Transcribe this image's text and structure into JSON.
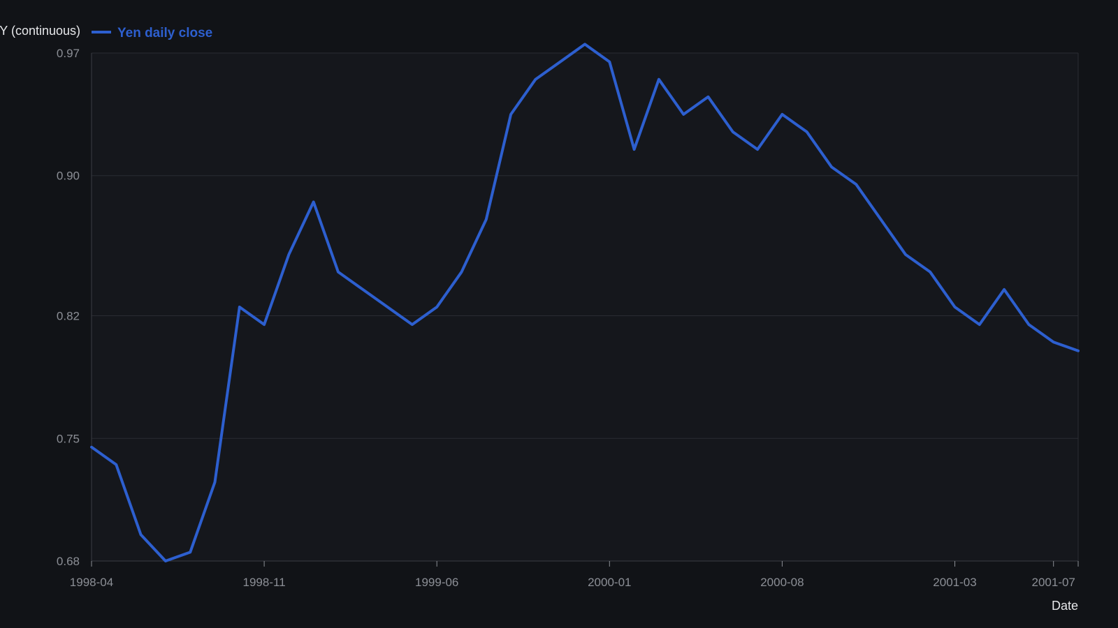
{
  "chart_data": {
    "type": "line",
    "xlabel": "Date",
    "ylabel": "JPY/USD (continuous)",
    "ylabel_visible": "Y (continuous)",
    "ylim": [
      0.68,
      0.97
    ],
    "xlim": [
      "1998-04",
      "2001-08"
    ],
    "grid": true,
    "legend_position": "top-left",
    "x_ticks": [
      "1998-04",
      "1998-11",
      "1999-06",
      "2000-01",
      "2000-08",
      "2001-03",
      "2001-07"
    ],
    "y_ticks": [
      "0.68",
      "0.75",
      "0.82",
      "0.90",
      "0.97"
    ],
    "colors": {
      "background": "#111317",
      "plot_background": "#15171c",
      "series": "#2d5fcf",
      "grid": "#2a2d33",
      "tick_text": "#8c8f96",
      "axis_title": "#e6e7ea"
    },
    "series": [
      {
        "name": "Yen daily close",
        "x": [
          "1998-04",
          "1998-05",
          "1998-06",
          "1998-07",
          "1998-08",
          "1998-09",
          "1998-10",
          "1998-11",
          "1998-12",
          "1999-01",
          "1999-02",
          "1999-03",
          "1999-04",
          "1999-05",
          "1999-06",
          "1999-07",
          "1999-08",
          "1999-09",
          "1999-10",
          "1999-11",
          "1999-12",
          "2000-01",
          "2000-02",
          "2000-03",
          "2000-04",
          "2000-05",
          "2000-06",
          "2000-07",
          "2000-08",
          "2000-09",
          "2000-10",
          "2000-11",
          "2000-12",
          "2001-01",
          "2001-02",
          "2001-03",
          "2001-04",
          "2001-05",
          "2001-06",
          "2001-07",
          "2001-08"
        ],
        "values": [
          0.745,
          0.735,
          0.695,
          0.68,
          0.685,
          0.725,
          0.825,
          0.815,
          0.855,
          0.885,
          0.845,
          0.835,
          0.825,
          0.815,
          0.825,
          0.845,
          0.875,
          0.935,
          0.955,
          0.965,
          0.975,
          0.965,
          0.915,
          0.955,
          0.935,
          0.945,
          0.925,
          0.915,
          0.935,
          0.925,
          0.905,
          0.895,
          0.875,
          0.855,
          0.845,
          0.825,
          0.815,
          0.835,
          0.815,
          0.805,
          0.8
        ]
      }
    ]
  }
}
